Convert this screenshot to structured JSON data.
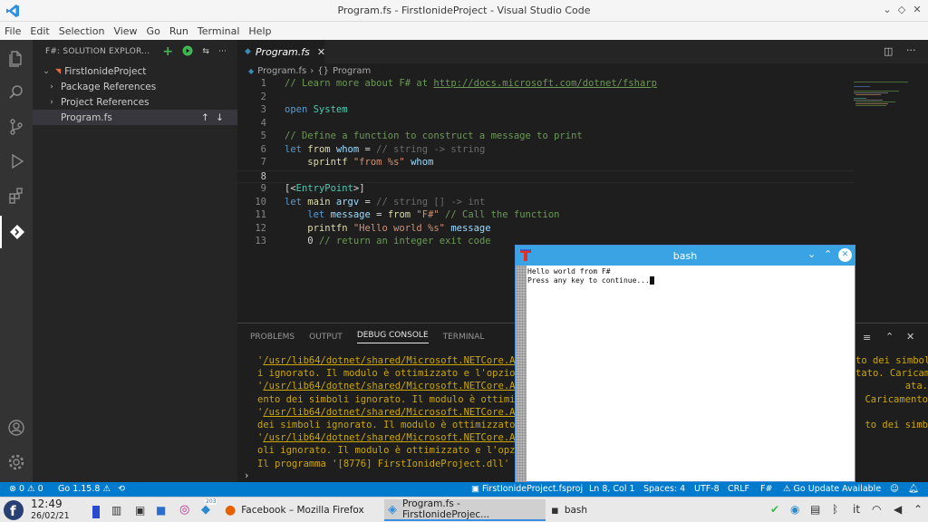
{
  "window": {
    "title": "Program.fs - FirstIonideProject - Visual Studio Code"
  },
  "menu": [
    "File",
    "Edit",
    "Selection",
    "View",
    "Go",
    "Run",
    "Terminal",
    "Help"
  ],
  "sidebar": {
    "header": "F#: SOLUTION EXPLOR...",
    "project": "FirstIonideProject",
    "items": [
      "Package References",
      "Project References",
      "Program.fs"
    ]
  },
  "editor": {
    "tab": "Program.fs",
    "breadcrumb": {
      "file": "Program.fs",
      "symbol": "Program"
    },
    "lines": [
      {
        "n": "1",
        "parts": [
          {
            "c": "c-com",
            "t": "// Learn more about F# at "
          },
          {
            "c": "c-com u",
            "t": "http://docs.microsoft.com/dotnet/fsharp"
          }
        ]
      },
      {
        "n": "2",
        "parts": []
      },
      {
        "n": "3",
        "parts": [
          {
            "c": "c-kw",
            "t": "open "
          },
          {
            "c": "c-ty",
            "t": "System"
          }
        ]
      },
      {
        "n": "4",
        "parts": []
      },
      {
        "n": "5",
        "parts": [
          {
            "c": "c-com",
            "t": "// Define a function to construct a message to print"
          }
        ]
      },
      {
        "n": "6",
        "parts": [
          {
            "c": "c-kw",
            "t": "let "
          },
          {
            "c": "c-fn",
            "t": "from "
          },
          {
            "c": "c-id",
            "t": "whom "
          },
          {
            "c": "c-pl",
            "t": "= "
          },
          {
            "c": "c-gray",
            "t": "// string -> string"
          }
        ]
      },
      {
        "n": "7",
        "parts": [
          {
            "c": "c-fn",
            "t": "    sprintf "
          },
          {
            "c": "c-str",
            "t": "\"from %s\" "
          },
          {
            "c": "c-id",
            "t": "whom"
          }
        ]
      },
      {
        "n": "8",
        "parts": []
      },
      {
        "n": "9",
        "parts": [
          {
            "c": "c-pl",
            "t": "[<"
          },
          {
            "c": "c-ty",
            "t": "EntryPoint"
          },
          {
            "c": "c-pl",
            "t": ">]"
          }
        ]
      },
      {
        "n": "10",
        "parts": [
          {
            "c": "c-kw",
            "t": "let "
          },
          {
            "c": "c-fn",
            "t": "main "
          },
          {
            "c": "c-id",
            "t": "argv "
          },
          {
            "c": "c-pl",
            "t": "= "
          },
          {
            "c": "c-gray",
            "t": "// string [] -> int"
          }
        ]
      },
      {
        "n": "11",
        "parts": [
          {
            "c": "c-kw",
            "t": "    let "
          },
          {
            "c": "c-id",
            "t": "message "
          },
          {
            "c": "c-pl",
            "t": "= "
          },
          {
            "c": "c-fn",
            "t": "from "
          },
          {
            "c": "c-str",
            "t": "\"F#\" "
          },
          {
            "c": "c-com",
            "t": "// Call the function"
          }
        ]
      },
      {
        "n": "12",
        "parts": [
          {
            "c": "c-fn",
            "t": "    printfn "
          },
          {
            "c": "c-str",
            "t": "\"Hello world %s\" "
          },
          {
            "c": "c-id",
            "t": "message"
          }
        ]
      },
      {
        "n": "13",
        "parts": [
          {
            "c": "c-pl",
            "t": "    0 "
          },
          {
            "c": "c-com",
            "t": "// return an integer exit code"
          }
        ]
      }
    ]
  },
  "panel": {
    "tabs": [
      "PROBLEMS",
      "OUTPUT",
      "DEBUG CONSOLE",
      "TERMINAL"
    ],
    "active": "DEBUG CONSOLE",
    "output": [
      "'/usr/lib64/dotnet/shared/Microsoft.NETCore.A",
      "i ignorato. Il modulo è ottimizzato e l'opzio",
      "'/usr/lib64/dotnet/shared/Microsoft.NETCore.A",
      "ento dei simboli ignorato. Il modulo è ottimi",
      "'/usr/lib64/dotnet/shared/Microsoft.NETCore.A",
      "dei simboli ignorato. Il modulo è ottimizzato",
      "'/usr/lib64/dotnet/shared/Microsoft.NETCore.A",
      "oli ignorato. Il modulo è ottimizzato e l'opz",
      "Il programma '[8776] FirstIonideProject.dll' e"
    ],
    "output_right": [
      "to dei simbol",
      "tato. Caricam",
      "ata.",
      "Caricamento",
      "",
      "to dei simb",
      "",
      ""
    ]
  },
  "bash": {
    "title": "bash",
    "lines": [
      "Hello world from F#",
      "",
      "Press any key to continue..."
    ]
  },
  "status": {
    "errors": "0",
    "warnings": "0",
    "go": "Go 1.15.8",
    "project": "FirstIonideProject.fsproj",
    "position": "Ln 8, Col 1",
    "spaces": "Spaces: 4",
    "encoding": "UTF-8",
    "eol": "CRLF",
    "lang": "F#",
    "update": "Go Update Available"
  },
  "taskbar": {
    "time": "12:49",
    "date": "26/02/21",
    "tasks": [
      "Facebook – Mozilla Firefox",
      "Program.fs - FirstIonideProjec...",
      "bash"
    ],
    "badge": "203",
    "lang": "it"
  },
  "colors": {
    "accent": "#007acc",
    "bash_title": "#3aa3e3"
  }
}
